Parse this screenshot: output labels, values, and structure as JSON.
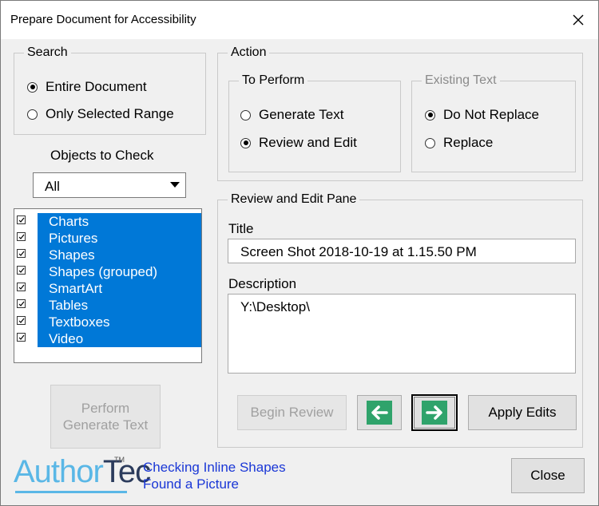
{
  "window": {
    "title": "Prepare Document for Accessibility"
  },
  "search": {
    "legend": "Search",
    "options": [
      {
        "label": "Entire Document",
        "checked": true
      },
      {
        "label": "Only Selected Range",
        "checked": false
      }
    ]
  },
  "objects": {
    "label": "Objects to Check",
    "selected": "All",
    "items": [
      "Charts",
      "Pictures",
      "Shapes",
      "Shapes (grouped)",
      "SmartArt",
      "Tables",
      "Textboxes",
      "Video"
    ]
  },
  "perform_button": {
    "line1": "Perform",
    "line2": "Generate Text"
  },
  "action": {
    "legend": "Action",
    "to_perform": {
      "legend": "To Perform",
      "options": [
        {
          "label": "Generate Text",
          "checked": false
        },
        {
          "label": "Review and Edit",
          "checked": true
        }
      ]
    },
    "existing_text": {
      "legend": "Existing Text",
      "options": [
        {
          "label": "Do Not Replace",
          "checked": true
        },
        {
          "label": "Replace",
          "checked": false
        }
      ]
    }
  },
  "review": {
    "legend": "Review and Edit Pane",
    "title_label": "Title",
    "title_value": "Screen Shot 2018-10-19 at 1.15.50 PM",
    "description_label": "Description",
    "description_value": "Y:\\Desktop\\",
    "begin_review": "Begin Review",
    "apply_edits": "Apply Edits"
  },
  "brand": {
    "part1": "Author",
    "part2": "Tec",
    "tm": "TM"
  },
  "status": {
    "line1": "Checking Inline Shapes",
    "line2": "Found a Picture"
  },
  "close_button": "Close",
  "colors": {
    "selection": "#0078d7",
    "nav_green": "#2fa36b",
    "status_text": "#1a37d6",
    "brand_light": "#5ab7e6",
    "brand_dark": "#2b3b5c"
  }
}
